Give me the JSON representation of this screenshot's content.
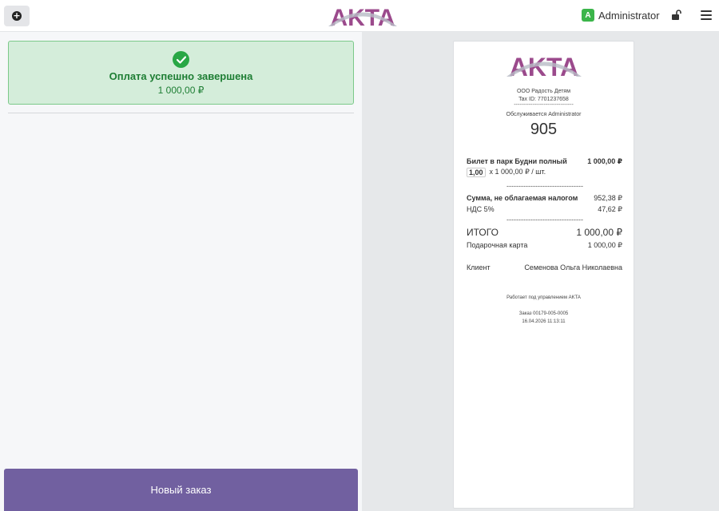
{
  "header": {
    "brand": "AKTA",
    "user_initial": "A",
    "user_name": "Administrator"
  },
  "payment": {
    "status_title": "Оплата успешно завершена",
    "amount": "1 000,00 ₽"
  },
  "new_order_label": "Новый заказ",
  "receipt": {
    "brand": "AKTA",
    "company": "ООО Радость Детям",
    "tax_id": "Tax ID: 7701237658",
    "dashes": "--------------------------------",
    "served_by": "Обслуживается Administrator",
    "number": "905",
    "item": {
      "name": "Билет в парк Будни полный",
      "total": "1 000,00 ₽",
      "qty": "1,00",
      "unit_price": "x 1 000,00 ₽ / шт."
    },
    "separator": "--------------------------------",
    "untaxed_label": "Сумма, не облагаемая налогом",
    "untaxed_value": "952,38 ₽",
    "vat_label": "НДС 5%",
    "vat_value": "47,62 ₽",
    "total_label": "ИТОГО",
    "total_value": "1 000,00 ₽",
    "payment_method": "Подарочная карта",
    "payment_value": "1 000,00 ₽",
    "client_label": "Клиент",
    "client_name": "Семенова Ольга Николаевна",
    "powered_by": "Работает под управлением AKTA",
    "order": "Заказ 00179-005-0005",
    "datetime": "16.04.2026 11:13:11"
  },
  "colors": {
    "accent": "#7160a0",
    "success_bg": "#d4edda",
    "success_text": "#1e7e34",
    "logo_purple": "#9b4a8c",
    "logo_gray": "#b8bcc6"
  }
}
